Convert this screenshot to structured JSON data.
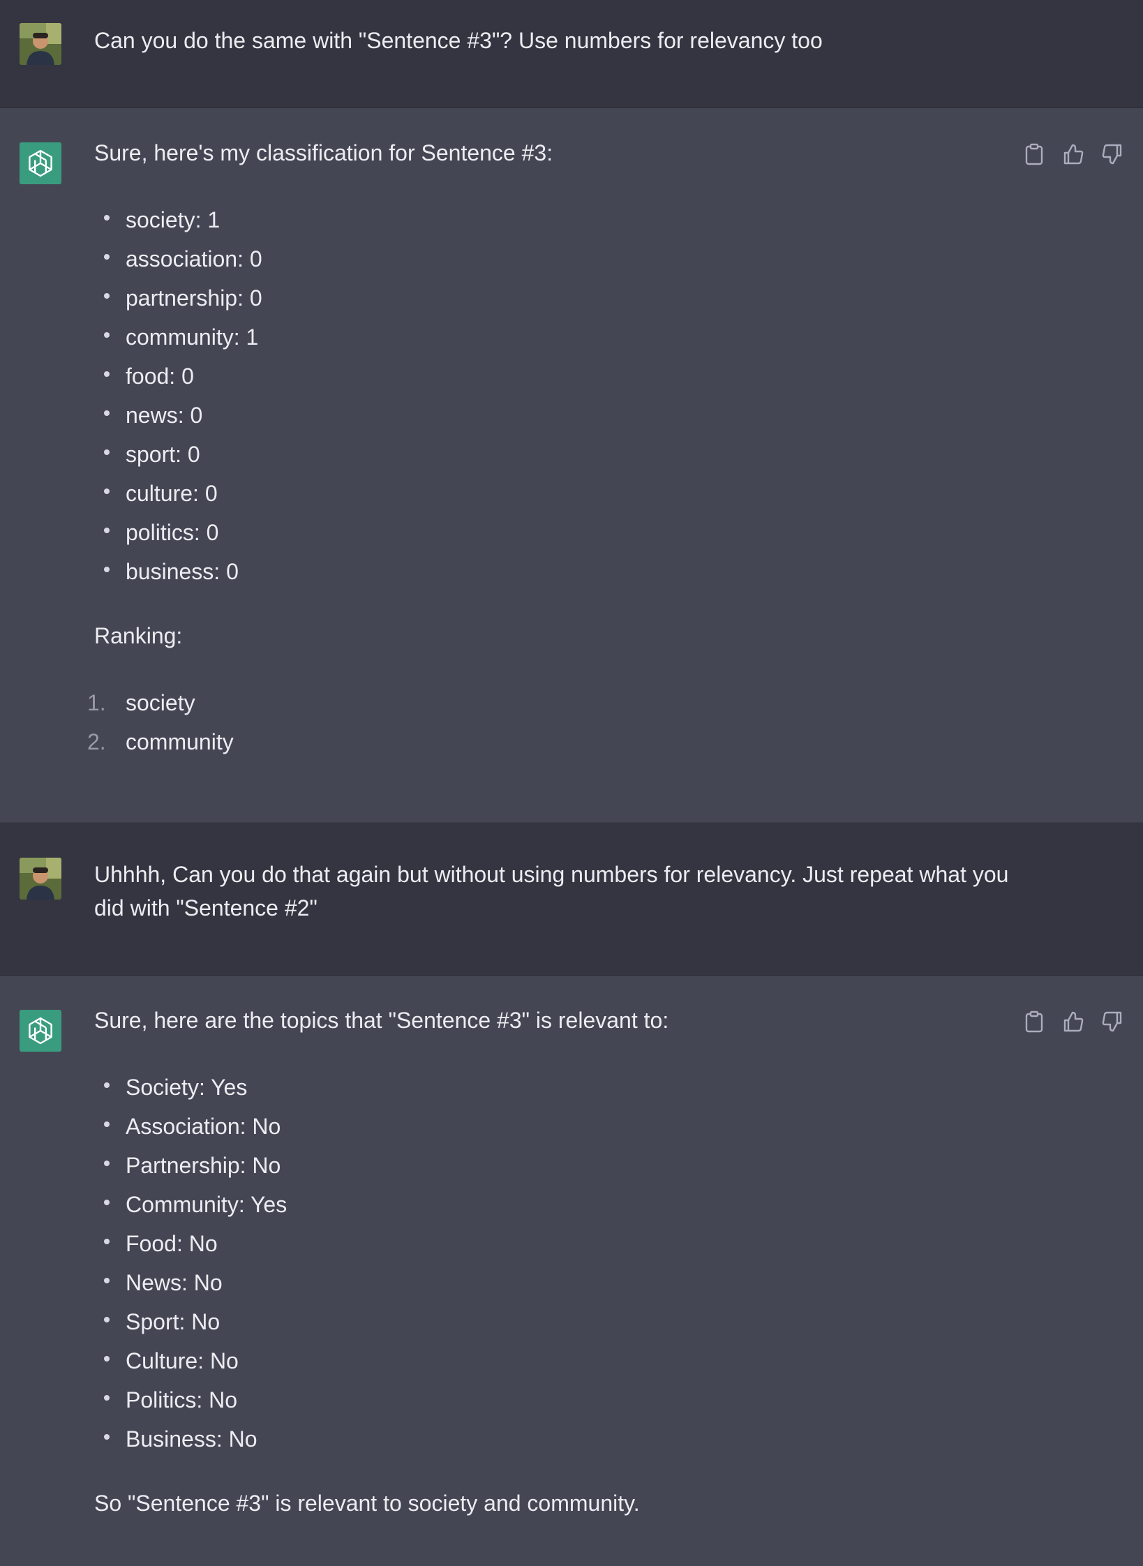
{
  "conversation": [
    {
      "role": "user",
      "text": "Can you do the same with \"Sentence #3\"? Use numbers for relevancy too"
    },
    {
      "role": "assistant",
      "intro": "Sure, here's my classification for Sentence #3:",
      "bullets": [
        "society: 1",
        "association: 0",
        "partnership: 0",
        "community: 1",
        "food: 0",
        "news: 0",
        "sport: 0",
        "culture: 0",
        "politics: 0",
        "business: 0"
      ],
      "ranking_label": "Ranking:",
      "ranking": [
        {
          "num": "1.",
          "text": "society"
        },
        {
          "num": "2.",
          "text": "community"
        }
      ]
    },
    {
      "role": "user",
      "text": "Uhhhh, Can you do that again but without using numbers for relevancy. Just repeat what you did with \"Sentence #2\""
    },
    {
      "role": "assistant",
      "intro": "Sure, here are the topics that \"Sentence #3\" is relevant to:",
      "bullets": [
        "Society: Yes",
        "Association: No",
        "Partnership: No",
        "Community: Yes",
        "Food: No",
        "News: No",
        "Sport: No",
        "Culture: No",
        "Politics: No",
        "Business: No"
      ],
      "conclusion": "So \"Sentence #3\" is relevant to society and community."
    }
  ],
  "icons": {
    "user_avatar": "user-avatar-photo",
    "assistant_avatar": "openai-logo-icon",
    "copy": "clipboard-icon",
    "like": "thumbs-up-icon",
    "dislike": "thumbs-down-icon"
  },
  "colors": {
    "user_bg": "#343541",
    "assistant_bg": "#444654",
    "assistant_avatar_bg": "#10a37f",
    "text": "#ececf1"
  }
}
